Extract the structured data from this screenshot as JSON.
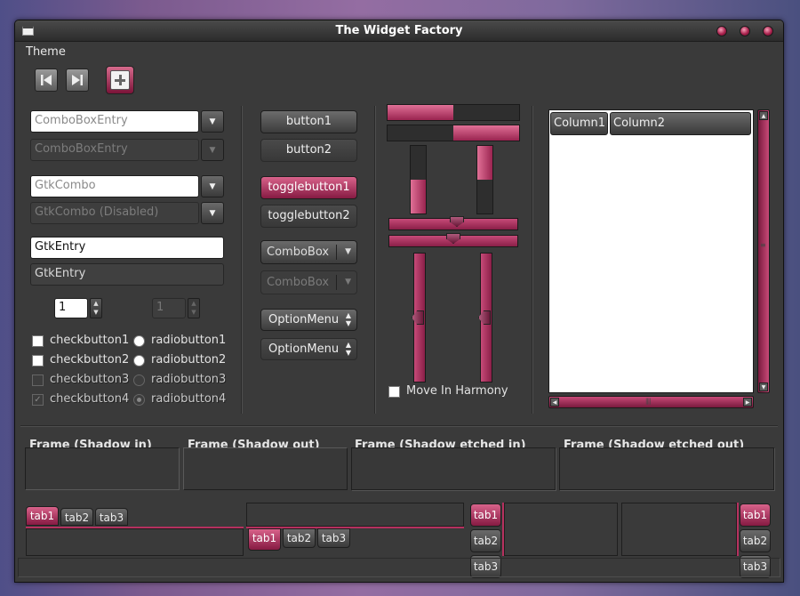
{
  "window": {
    "title": "The Widget Factory",
    "accent_color": "#b5305e",
    "background_color": "#3a3a3a"
  },
  "menubar": {
    "items": [
      "Theme"
    ]
  },
  "toolbar": {
    "buttons": [
      {
        "icon": "skip-first-icon"
      },
      {
        "icon": "skip-last-icon"
      },
      {
        "icon": "add-icon"
      }
    ]
  },
  "left_column": {
    "combo_entry_1": {
      "placeholder": "ComboBoxEntry"
    },
    "combo_entry_2": {
      "placeholder": "ComboBoxEntry"
    },
    "gtk_combo_1": {
      "placeholder": "GtkCombo"
    },
    "gtk_combo_2": {
      "placeholder": "GtkCombo (Disabled)"
    },
    "entry_1": {
      "value": "GtkEntry"
    },
    "entry_2": {
      "value": "GtkEntry"
    },
    "spin_1": {
      "value": "1"
    },
    "spin_2": {
      "value": "1"
    },
    "checkbuttons": [
      "checkbutton1",
      "checkbutton2",
      "checkbutton3",
      "checkbutton4"
    ],
    "radiobuttons": [
      "radiobutton1",
      "radiobutton2",
      "radiobutton3",
      "radiobutton4"
    ]
  },
  "middle_column": {
    "button1": "button1",
    "button2": "button2",
    "toggle1": "togglebutton1",
    "toggle2": "togglebutton2",
    "combobox1": "ComboBox",
    "combobox2": "ComboBox",
    "optionmenu1": "OptionMenu",
    "optionmenu2": "OptionMenu"
  },
  "ranges": {
    "progress_h1": 0.5,
    "progress_h2": 0.5,
    "progress_v1": 0.5,
    "progress_v2": 0.5,
    "move_in_harmony": "Move In Harmony"
  },
  "tree": {
    "columns": [
      "Column1",
      "Column2"
    ]
  },
  "frames": [
    "Frame (Shadow in)",
    "Frame (Shadow out)",
    "Frame (Shadow etched in)",
    "Frame (Shadow etched out)"
  ],
  "tabs": [
    "tab1",
    "tab2",
    "tab3"
  ]
}
